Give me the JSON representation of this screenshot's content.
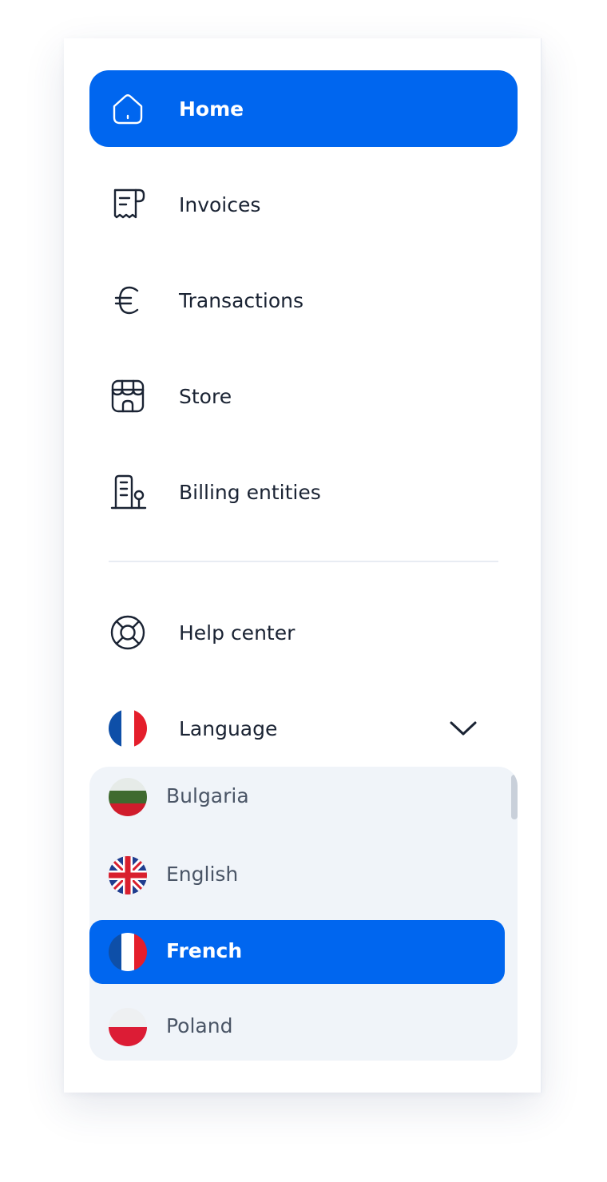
{
  "nav": {
    "items": [
      {
        "label": "Home",
        "icon": "home-icon",
        "active": true
      },
      {
        "label": "Invoices",
        "icon": "receipt-icon",
        "active": false
      },
      {
        "label": "Transactions",
        "icon": "euro-icon",
        "active": false
      },
      {
        "label": "Store",
        "icon": "storefront-icon",
        "active": false
      },
      {
        "label": "Billing entities",
        "icon": "building-icon",
        "active": false
      }
    ]
  },
  "support": {
    "help_label": "Help center",
    "help_icon": "lifebuoy-icon"
  },
  "language": {
    "label": "Language",
    "current_flag": "france-flag-icon",
    "options": [
      {
        "label": "Bulgaria",
        "flag": "bulgaria-flag-icon",
        "selected": false
      },
      {
        "label": "English",
        "flag": "uk-flag-icon",
        "selected": false
      },
      {
        "label": "French",
        "flag": "france-flag-icon",
        "selected": true
      },
      {
        "label": "Poland",
        "flag": "poland-flag-icon",
        "selected": false
      }
    ]
  },
  "colors": {
    "accent": "#0066ef",
    "dropdown_bg": "#f0f4f9",
    "text": "#1a2333",
    "muted_text": "#4a5566"
  }
}
